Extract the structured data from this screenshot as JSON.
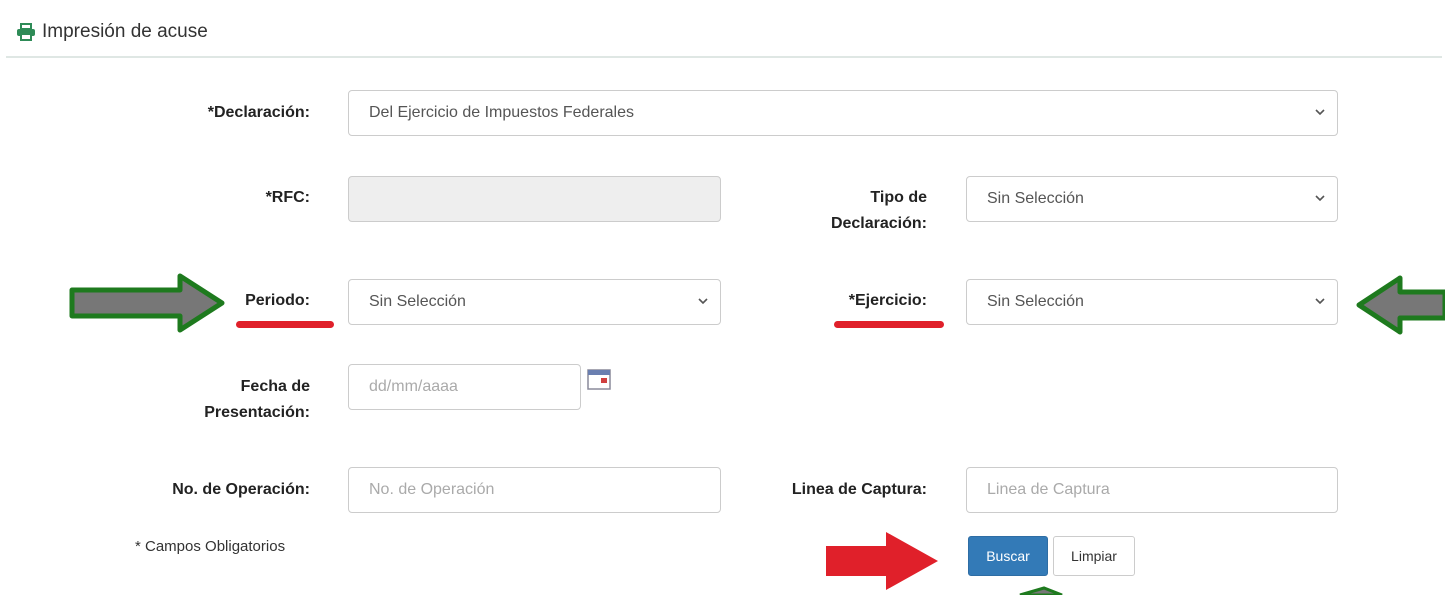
{
  "panel": {
    "title": "Impresión de acuse"
  },
  "form": {
    "declaracion": {
      "label": "*Declaración:",
      "value": "Del Ejercicio de Impuestos Federales"
    },
    "rfc": {
      "label": "*RFC:",
      "value": ""
    },
    "tipo_declaracion": {
      "label_line1": "Tipo de",
      "label_line2": "Declaración:",
      "value": "Sin Selección"
    },
    "periodo": {
      "label": "Periodo:",
      "value": "Sin Selección"
    },
    "ejercicio": {
      "label": "*Ejercicio:",
      "value": "Sin Selección"
    },
    "fecha_presentacion": {
      "label_line1": "Fecha de",
      "label_line2": "Presentación:",
      "placeholder": "dd/mm/aaaa"
    },
    "no_operacion": {
      "label": "No. de Operación:",
      "placeholder": "No. de Operación"
    },
    "linea_captura": {
      "label": "Linea de Captura:",
      "placeholder": "Linea de Captura"
    },
    "required_note": "* Campos Obligatorios"
  },
  "buttons": {
    "buscar": "Buscar",
    "limpiar": "Limpiar"
  },
  "colors": {
    "primary": "#337ab7",
    "annotation_red": "#e0202a",
    "annotation_green": "#1e7a1e",
    "printer_icon": "#2e8b57"
  }
}
